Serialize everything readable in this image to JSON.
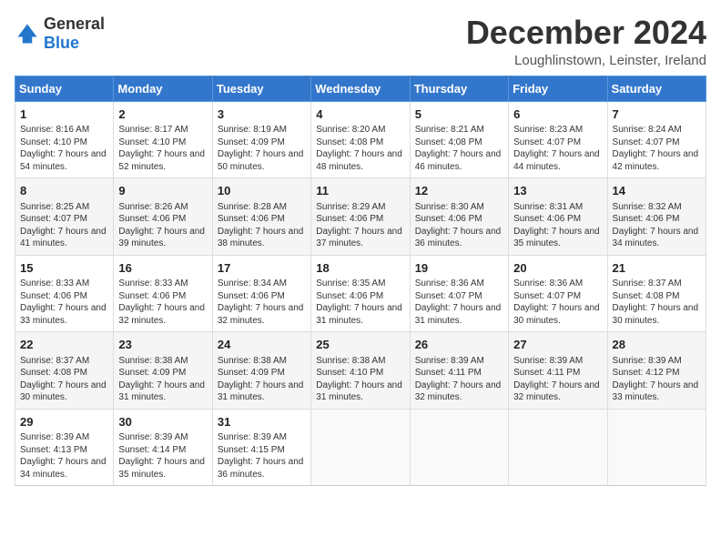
{
  "header": {
    "logo_general": "General",
    "logo_blue": "Blue",
    "title": "December 2024",
    "location": "Loughlinstown, Leinster, Ireland"
  },
  "days_of_week": [
    "Sunday",
    "Monday",
    "Tuesday",
    "Wednesday",
    "Thursday",
    "Friday",
    "Saturday"
  ],
  "weeks": [
    [
      {
        "day": "1",
        "sunrise": "Sunrise: 8:16 AM",
        "sunset": "Sunset: 4:10 PM",
        "daylight": "Daylight: 7 hours and 54 minutes."
      },
      {
        "day": "2",
        "sunrise": "Sunrise: 8:17 AM",
        "sunset": "Sunset: 4:10 PM",
        "daylight": "Daylight: 7 hours and 52 minutes."
      },
      {
        "day": "3",
        "sunrise": "Sunrise: 8:19 AM",
        "sunset": "Sunset: 4:09 PM",
        "daylight": "Daylight: 7 hours and 50 minutes."
      },
      {
        "day": "4",
        "sunrise": "Sunrise: 8:20 AM",
        "sunset": "Sunset: 4:08 PM",
        "daylight": "Daylight: 7 hours and 48 minutes."
      },
      {
        "day": "5",
        "sunrise": "Sunrise: 8:21 AM",
        "sunset": "Sunset: 4:08 PM",
        "daylight": "Daylight: 7 hours and 46 minutes."
      },
      {
        "day": "6",
        "sunrise": "Sunrise: 8:23 AM",
        "sunset": "Sunset: 4:07 PM",
        "daylight": "Daylight: 7 hours and 44 minutes."
      },
      {
        "day": "7",
        "sunrise": "Sunrise: 8:24 AM",
        "sunset": "Sunset: 4:07 PM",
        "daylight": "Daylight: 7 hours and 42 minutes."
      }
    ],
    [
      {
        "day": "8",
        "sunrise": "Sunrise: 8:25 AM",
        "sunset": "Sunset: 4:07 PM",
        "daylight": "Daylight: 7 hours and 41 minutes."
      },
      {
        "day": "9",
        "sunrise": "Sunrise: 8:26 AM",
        "sunset": "Sunset: 4:06 PM",
        "daylight": "Daylight: 7 hours and 39 minutes."
      },
      {
        "day": "10",
        "sunrise": "Sunrise: 8:28 AM",
        "sunset": "Sunset: 4:06 PM",
        "daylight": "Daylight: 7 hours and 38 minutes."
      },
      {
        "day": "11",
        "sunrise": "Sunrise: 8:29 AM",
        "sunset": "Sunset: 4:06 PM",
        "daylight": "Daylight: 7 hours and 37 minutes."
      },
      {
        "day": "12",
        "sunrise": "Sunrise: 8:30 AM",
        "sunset": "Sunset: 4:06 PM",
        "daylight": "Daylight: 7 hours and 36 minutes."
      },
      {
        "day": "13",
        "sunrise": "Sunrise: 8:31 AM",
        "sunset": "Sunset: 4:06 PM",
        "daylight": "Daylight: 7 hours and 35 minutes."
      },
      {
        "day": "14",
        "sunrise": "Sunrise: 8:32 AM",
        "sunset": "Sunset: 4:06 PM",
        "daylight": "Daylight: 7 hours and 34 minutes."
      }
    ],
    [
      {
        "day": "15",
        "sunrise": "Sunrise: 8:33 AM",
        "sunset": "Sunset: 4:06 PM",
        "daylight": "Daylight: 7 hours and 33 minutes."
      },
      {
        "day": "16",
        "sunrise": "Sunrise: 8:33 AM",
        "sunset": "Sunset: 4:06 PM",
        "daylight": "Daylight: 7 hours and 32 minutes."
      },
      {
        "day": "17",
        "sunrise": "Sunrise: 8:34 AM",
        "sunset": "Sunset: 4:06 PM",
        "daylight": "Daylight: 7 hours and 32 minutes."
      },
      {
        "day": "18",
        "sunrise": "Sunrise: 8:35 AM",
        "sunset": "Sunset: 4:06 PM",
        "daylight": "Daylight: 7 hours and 31 minutes."
      },
      {
        "day": "19",
        "sunrise": "Sunrise: 8:36 AM",
        "sunset": "Sunset: 4:07 PM",
        "daylight": "Daylight: 7 hours and 31 minutes."
      },
      {
        "day": "20",
        "sunrise": "Sunrise: 8:36 AM",
        "sunset": "Sunset: 4:07 PM",
        "daylight": "Daylight: 7 hours and 30 minutes."
      },
      {
        "day": "21",
        "sunrise": "Sunrise: 8:37 AM",
        "sunset": "Sunset: 4:08 PM",
        "daylight": "Daylight: 7 hours and 30 minutes."
      }
    ],
    [
      {
        "day": "22",
        "sunrise": "Sunrise: 8:37 AM",
        "sunset": "Sunset: 4:08 PM",
        "daylight": "Daylight: 7 hours and 30 minutes."
      },
      {
        "day": "23",
        "sunrise": "Sunrise: 8:38 AM",
        "sunset": "Sunset: 4:09 PM",
        "daylight": "Daylight: 7 hours and 31 minutes."
      },
      {
        "day": "24",
        "sunrise": "Sunrise: 8:38 AM",
        "sunset": "Sunset: 4:09 PM",
        "daylight": "Daylight: 7 hours and 31 minutes."
      },
      {
        "day": "25",
        "sunrise": "Sunrise: 8:38 AM",
        "sunset": "Sunset: 4:10 PM",
        "daylight": "Daylight: 7 hours and 31 minutes."
      },
      {
        "day": "26",
        "sunrise": "Sunrise: 8:39 AM",
        "sunset": "Sunset: 4:11 PM",
        "daylight": "Daylight: 7 hours and 32 minutes."
      },
      {
        "day": "27",
        "sunrise": "Sunrise: 8:39 AM",
        "sunset": "Sunset: 4:11 PM",
        "daylight": "Daylight: 7 hours and 32 minutes."
      },
      {
        "day": "28",
        "sunrise": "Sunrise: 8:39 AM",
        "sunset": "Sunset: 4:12 PM",
        "daylight": "Daylight: 7 hours and 33 minutes."
      }
    ],
    [
      {
        "day": "29",
        "sunrise": "Sunrise: 8:39 AM",
        "sunset": "Sunset: 4:13 PM",
        "daylight": "Daylight: 7 hours and 34 minutes."
      },
      {
        "day": "30",
        "sunrise": "Sunrise: 8:39 AM",
        "sunset": "Sunset: 4:14 PM",
        "daylight": "Daylight: 7 hours and 35 minutes."
      },
      {
        "day": "31",
        "sunrise": "Sunrise: 8:39 AM",
        "sunset": "Sunset: 4:15 PM",
        "daylight": "Daylight: 7 hours and 36 minutes."
      },
      null,
      null,
      null,
      null
    ]
  ]
}
